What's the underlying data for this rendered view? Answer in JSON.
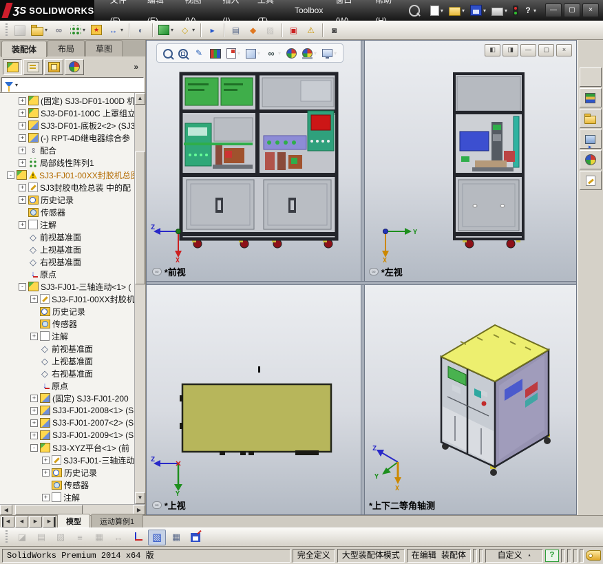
{
  "title_bar": {
    "brand_mark": "ƷS",
    "brand": "SOLIDWORKS",
    "menus": [
      "文件(F)",
      "编辑(E)",
      "视图(V)",
      "插入(I)",
      "工具(T)",
      "Toolbox",
      "窗口(W)",
      "帮助(H)"
    ],
    "quick": [
      {
        "name": "new-document",
        "icon": "new",
        "dropdown": true
      },
      {
        "name": "open-document",
        "icon": "open",
        "dropdown": true
      },
      {
        "name": "save-document",
        "icon": "save",
        "dropdown": true
      },
      {
        "name": "print-document",
        "icon": "print",
        "dropdown": true
      },
      {
        "name": "performance-monitor",
        "icon": "performance"
      },
      {
        "name": "help",
        "icon": "help",
        "glyph": "?",
        "dropdown": true
      }
    ],
    "window_buttons": [
      {
        "name": "minimize-window",
        "glyph": "—"
      },
      {
        "name": "restore-window",
        "glyph": "▢"
      },
      {
        "name": "close-window",
        "glyph": "×"
      }
    ]
  },
  "assembly_toolbar": {
    "buttons": [
      {
        "name": "insert-component",
        "icon": "cube-gray",
        "disabled": true
      },
      {
        "name": "open-part",
        "icon": "folder",
        "dropdown": true
      },
      {
        "name": "mate",
        "icon": "clip",
        "glyph": "∞"
      },
      {
        "name": "linear-component-pattern",
        "icon": "pattern",
        "dropdown": true
      },
      {
        "name": "smart-fasteners",
        "icon": "star-box",
        "glyph": "★"
      },
      {
        "name": "move-component",
        "icon": "move",
        "glyph": "↔",
        "dropdown": true
      },
      {
        "sep": true
      },
      {
        "name": "show-hidden-components",
        "icon": "hidden",
        "glyph": "◐"
      },
      {
        "sep": true
      },
      {
        "name": "assembly-features",
        "icon": "green-box",
        "dropdown": true
      },
      {
        "name": "reference-geometry",
        "icon": "geom",
        "glyph": "◇",
        "dropdown": true
      },
      {
        "sep": true
      },
      {
        "name": "new-motion-study",
        "icon": "motion",
        "glyph": "▸"
      },
      {
        "sep": true
      },
      {
        "name": "bill-of-materials",
        "icon": "bom",
        "glyph": "▤"
      },
      {
        "name": "exploded-view",
        "icon": "explode",
        "glyph": "◆"
      },
      {
        "name": "explode-line-sketch",
        "icon": "pencil-gray",
        "glyph": "▨",
        "disabled": true
      },
      {
        "sep": true
      },
      {
        "name": "interference-detection",
        "icon": "interfere",
        "glyph": "▣"
      },
      {
        "name": "assembly-xpert",
        "icon": "warncheck",
        "glyph": "⚠"
      },
      {
        "sep": true
      },
      {
        "name": "take-snapshot",
        "icon": "snapshot",
        "glyph": "◙"
      }
    ]
  },
  "left_panel": {
    "tabs": [
      {
        "label": "装配体",
        "active": true
      },
      {
        "label": "布局",
        "active": false
      },
      {
        "label": "草图",
        "active": false
      }
    ],
    "manager_tabs": [
      "feature-manager",
      "property-manager",
      "configuration-manager",
      "display-manager"
    ],
    "overflow_label": "»",
    "tree": [
      {
        "level": 1,
        "expand": "+",
        "icon": "asm",
        "label": "(固定) SJ3-DF01-100D 机"
      },
      {
        "level": 1,
        "expand": "+",
        "icon": "asm",
        "label": "SJ3-DF01-100C 上罩组立"
      },
      {
        "level": 1,
        "expand": "+",
        "icon": "part",
        "label": "SJ3-DF01-底板2<2> (SJ3-"
      },
      {
        "level": 1,
        "expand": "+",
        "icon": "part",
        "label": "(-) RPT-4D继电器综合参"
      },
      {
        "level": 1,
        "expand": "+",
        "icon": "mate",
        "label": "配合"
      },
      {
        "level": 1,
        "expand": "+",
        "icon": "pattern",
        "label": "局部线性阵列1"
      },
      {
        "level": 0,
        "expand": "-",
        "icon": "asm",
        "warn": true,
        "label": "SJ3-FJ01-00XX封胶机总图",
        "color": "#b36b00"
      },
      {
        "level": 1,
        "expand": "+",
        "icon": "edit",
        "label": "SJ3封胶电检总装 中的配"
      },
      {
        "level": 1,
        "expand": "+",
        "icon": "history",
        "label": "历史记录"
      },
      {
        "level": 1,
        "icon": "sensor",
        "label": "传感器"
      },
      {
        "level": 1,
        "expand": "+",
        "icon": "ann",
        "label": "注解"
      },
      {
        "level": 1,
        "icon": "plane",
        "glyph": "◇",
        "label": "前视基准面"
      },
      {
        "level": 1,
        "icon": "plane",
        "glyph": "◇",
        "label": "上视基准面"
      },
      {
        "level": 1,
        "icon": "plane",
        "glyph": "◇",
        "label": "右视基准面"
      },
      {
        "level": 1,
        "icon": "origin",
        "glyph": "↓",
        "label": "原点"
      },
      {
        "level": 1,
        "expand": "-",
        "icon": "asm",
        "label": "SJ3-FJ01-三轴连动<1> ("
      },
      {
        "level": 2,
        "expand": "+",
        "icon": "edit",
        "label": "SJ3-FJ01-00XX封胶机."
      },
      {
        "level": 2,
        "icon": "history",
        "label": "历史记录"
      },
      {
        "level": 2,
        "icon": "sensor",
        "label": "传感器"
      },
      {
        "level": 2,
        "expand": "+",
        "icon": "ann",
        "label": "注解"
      },
      {
        "level": 2,
        "icon": "plane",
        "glyph": "◇",
        "label": "前视基准面"
      },
      {
        "level": 2,
        "icon": "plane",
        "glyph": "◇",
        "label": "上视基准面"
      },
      {
        "level": 2,
        "icon": "plane",
        "glyph": "◇",
        "label": "右视基准面"
      },
      {
        "level": 2,
        "icon": "origin",
        "glyph": "↓",
        "label": "原点"
      },
      {
        "level": 2,
        "expand": "+",
        "icon": "part",
        "label": "(固定) SJ3-FJ01-200"
      },
      {
        "level": 2,
        "expand": "+",
        "icon": "part",
        "label": "SJ3-FJ01-2008<1> (S."
      },
      {
        "level": 2,
        "expand": "+",
        "icon": "part",
        "label": "SJ3-FJ01-2007<2> (S."
      },
      {
        "level": 2,
        "expand": "+",
        "icon": "part",
        "label": "SJ3-FJ01-2009<1> (S."
      },
      {
        "level": 2,
        "expand": "-",
        "icon": "asm",
        "label": "SJ3-XYZ平台<1> (前"
      },
      {
        "level": 3,
        "expand": "+",
        "icon": "edit",
        "label": "SJ3-FJ01-三轴连动"
      },
      {
        "level": 3,
        "expand": "+",
        "icon": "history",
        "label": "历史记录"
      },
      {
        "level": 3,
        "icon": "sensor",
        "label": "传感器"
      },
      {
        "level": 3,
        "expand": "+",
        "icon": "ann",
        "label": "注解"
      }
    ],
    "nav": [
      {
        "name": "first-tab",
        "glyph": "◀",
        "bar": "l"
      },
      {
        "name": "previous-tab",
        "glyph": "◀"
      },
      {
        "name": "next-tab",
        "glyph": "▶"
      },
      {
        "name": "last-tab",
        "glyph": "▶",
        "bar": "r"
      }
    ],
    "bottom_tabs": [
      {
        "label": "模型",
        "active": true
      },
      {
        "label": "运动算例1",
        "active": false
      }
    ]
  },
  "graphics": {
    "heads_up": [
      {
        "name": "zoom-fit"
      },
      {
        "name": "zoom-area"
      },
      {
        "name": "magnify",
        "glyph": "✎"
      },
      {
        "name": "section-view"
      },
      {
        "name": "drawing-section",
        "dropdown": true
      },
      {
        "name": "view-orientation",
        "dropdown": true
      },
      {
        "name": "hide-show",
        "glyph": "∞",
        "dropdown": true
      },
      {
        "name": "appearance"
      },
      {
        "name": "scene",
        "dropdown": true
      },
      {
        "name": "view-settings",
        "dropdown": true
      }
    ],
    "doc_buttons": [
      {
        "name": "left-pane-toggle",
        "glyph": "◧"
      },
      {
        "name": "right-pane-toggle",
        "glyph": "◨"
      },
      {
        "name": "minimize-document",
        "glyph": "—"
      },
      {
        "name": "restore-document",
        "glyph": "▢"
      },
      {
        "name": "close-document",
        "glyph": "×"
      }
    ],
    "viewports": [
      {
        "name": "front",
        "label": "*前视",
        "linked": true,
        "axes": [
          {
            "letter": "Z",
            "color": "#2929c8"
          },
          {
            "letter": "X",
            "color": "#cc2020"
          }
        ]
      },
      {
        "name": "left",
        "label": "*左视",
        "linked": true,
        "axes": [
          {
            "letter": "Y",
            "color": "#1e8f1e"
          },
          {
            "letter": "X",
            "color": "#cc8800"
          }
        ]
      },
      {
        "name": "top",
        "label": "*上视",
        "linked": true,
        "axes": [
          {
            "letter": "Z",
            "color": "#2929c8"
          },
          {
            "letter": "Y",
            "color": "#1e8f1e"
          }
        ]
      },
      {
        "name": "isometric",
        "label": "*上下二等角轴测",
        "linked": false,
        "axes": [
          {
            "letter": "Z",
            "color": "#2929c8"
          },
          {
            "letter": "Y",
            "color": "#1e8f1e"
          },
          {
            "letter": "X",
            "color": "#cc8800"
          }
        ]
      }
    ]
  },
  "task_pane": {
    "items": [
      "resources",
      "design-library",
      "file-explorer",
      "view-palette",
      "appearances",
      "custom-properties"
    ]
  },
  "bottom_toolbar": {
    "buttons": [
      {
        "name": "stacked-pages",
        "glyph": "◪",
        "disabled": true
      },
      {
        "name": "document-stack",
        "glyph": "▤",
        "disabled": true
      },
      {
        "name": "pen-tool",
        "glyph": "▨",
        "disabled": true
      },
      {
        "name": "line-list",
        "glyph": "≡",
        "disabled": true
      },
      {
        "name": "grid-table",
        "glyph": "▦",
        "disabled": true
      },
      {
        "name": "swap-arrows",
        "glyph": "↔",
        "disabled": true
      },
      {
        "name": "coordinate-axes"
      },
      {
        "name": "shaded-cube",
        "glyph": "▧",
        "pressed": true
      },
      {
        "name": "viewport-grid",
        "glyph": "▦"
      },
      {
        "name": "save-view"
      }
    ]
  },
  "status_bar": {
    "message": "SolidWorks Premium 2014 x64 版",
    "badges": [
      "完全定义",
      "大型装配体模式",
      "在编辑 装配体"
    ],
    "custom_label": "自定义",
    "help_label": "?"
  }
}
